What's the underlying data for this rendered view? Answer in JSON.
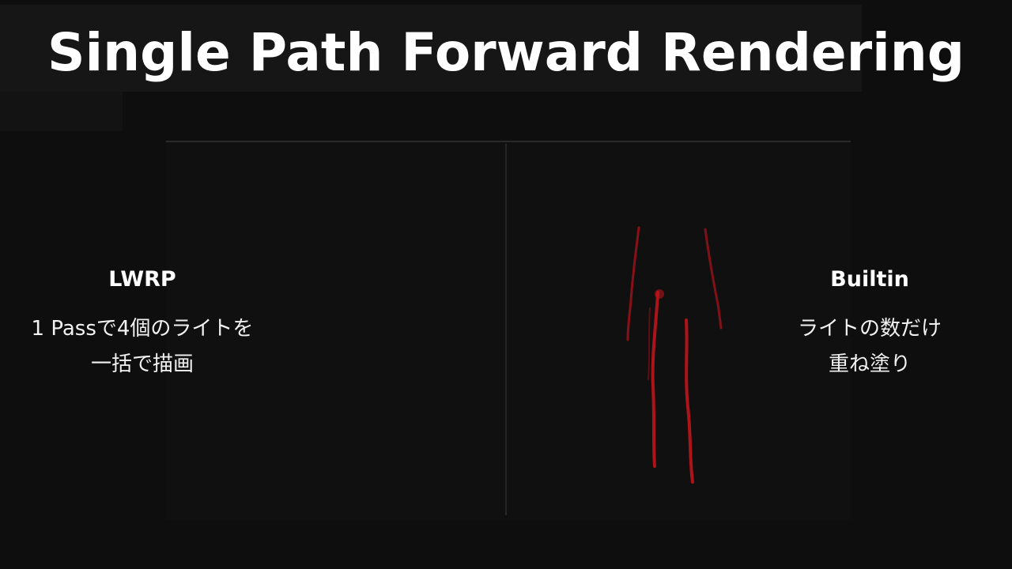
{
  "slide": {
    "title": "Single Path Forward Rendering"
  },
  "left_column": {
    "heading": "LWRP",
    "description_lines": [
      "1 Passで4個のライトを",
      "一括で描画"
    ]
  },
  "right_column": {
    "heading": "Builtin",
    "description_lines": [
      "ライトの数だけ",
      "重ね塗り"
    ]
  },
  "colors": {
    "background": "#0e0e0e",
    "text": "#ffffff",
    "light_streak": "#c0141c"
  }
}
